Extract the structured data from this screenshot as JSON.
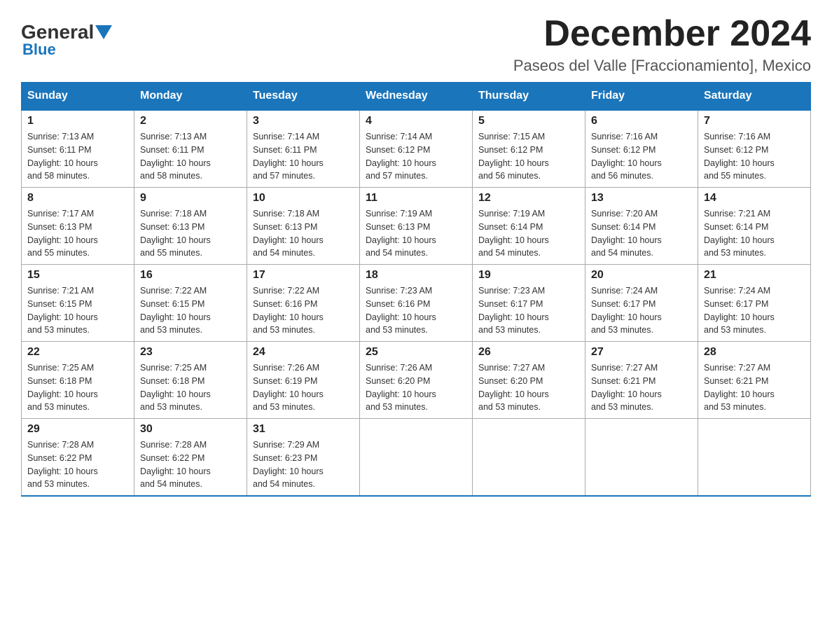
{
  "header": {
    "logo": {
      "general": "General",
      "blue": "Blue"
    },
    "title": "December 2024",
    "subtitle": "Paseos del Valle [Fraccionamiento], Mexico"
  },
  "calendar": {
    "days_of_week": [
      "Sunday",
      "Monday",
      "Tuesday",
      "Wednesday",
      "Thursday",
      "Friday",
      "Saturday"
    ],
    "weeks": [
      [
        {
          "day": "1",
          "sunrise": "7:13 AM",
          "sunset": "6:11 PM",
          "daylight": "10 hours and 58 minutes."
        },
        {
          "day": "2",
          "sunrise": "7:13 AM",
          "sunset": "6:11 PM",
          "daylight": "10 hours and 58 minutes."
        },
        {
          "day": "3",
          "sunrise": "7:14 AM",
          "sunset": "6:11 PM",
          "daylight": "10 hours and 57 minutes."
        },
        {
          "day": "4",
          "sunrise": "7:14 AM",
          "sunset": "6:12 PM",
          "daylight": "10 hours and 57 minutes."
        },
        {
          "day": "5",
          "sunrise": "7:15 AM",
          "sunset": "6:12 PM",
          "daylight": "10 hours and 56 minutes."
        },
        {
          "day": "6",
          "sunrise": "7:16 AM",
          "sunset": "6:12 PM",
          "daylight": "10 hours and 56 minutes."
        },
        {
          "day": "7",
          "sunrise": "7:16 AM",
          "sunset": "6:12 PM",
          "daylight": "10 hours and 55 minutes."
        }
      ],
      [
        {
          "day": "8",
          "sunrise": "7:17 AM",
          "sunset": "6:13 PM",
          "daylight": "10 hours and 55 minutes."
        },
        {
          "day": "9",
          "sunrise": "7:18 AM",
          "sunset": "6:13 PM",
          "daylight": "10 hours and 55 minutes."
        },
        {
          "day": "10",
          "sunrise": "7:18 AM",
          "sunset": "6:13 PM",
          "daylight": "10 hours and 54 minutes."
        },
        {
          "day": "11",
          "sunrise": "7:19 AM",
          "sunset": "6:13 PM",
          "daylight": "10 hours and 54 minutes."
        },
        {
          "day": "12",
          "sunrise": "7:19 AM",
          "sunset": "6:14 PM",
          "daylight": "10 hours and 54 minutes."
        },
        {
          "day": "13",
          "sunrise": "7:20 AM",
          "sunset": "6:14 PM",
          "daylight": "10 hours and 54 minutes."
        },
        {
          "day": "14",
          "sunrise": "7:21 AM",
          "sunset": "6:14 PM",
          "daylight": "10 hours and 53 minutes."
        }
      ],
      [
        {
          "day": "15",
          "sunrise": "7:21 AM",
          "sunset": "6:15 PM",
          "daylight": "10 hours and 53 minutes."
        },
        {
          "day": "16",
          "sunrise": "7:22 AM",
          "sunset": "6:15 PM",
          "daylight": "10 hours and 53 minutes."
        },
        {
          "day": "17",
          "sunrise": "7:22 AM",
          "sunset": "6:16 PM",
          "daylight": "10 hours and 53 minutes."
        },
        {
          "day": "18",
          "sunrise": "7:23 AM",
          "sunset": "6:16 PM",
          "daylight": "10 hours and 53 minutes."
        },
        {
          "day": "19",
          "sunrise": "7:23 AM",
          "sunset": "6:17 PM",
          "daylight": "10 hours and 53 minutes."
        },
        {
          "day": "20",
          "sunrise": "7:24 AM",
          "sunset": "6:17 PM",
          "daylight": "10 hours and 53 minutes."
        },
        {
          "day": "21",
          "sunrise": "7:24 AM",
          "sunset": "6:17 PM",
          "daylight": "10 hours and 53 minutes."
        }
      ],
      [
        {
          "day": "22",
          "sunrise": "7:25 AM",
          "sunset": "6:18 PM",
          "daylight": "10 hours and 53 minutes."
        },
        {
          "day": "23",
          "sunrise": "7:25 AM",
          "sunset": "6:18 PM",
          "daylight": "10 hours and 53 minutes."
        },
        {
          "day": "24",
          "sunrise": "7:26 AM",
          "sunset": "6:19 PM",
          "daylight": "10 hours and 53 minutes."
        },
        {
          "day": "25",
          "sunrise": "7:26 AM",
          "sunset": "6:20 PM",
          "daylight": "10 hours and 53 minutes."
        },
        {
          "day": "26",
          "sunrise": "7:27 AM",
          "sunset": "6:20 PM",
          "daylight": "10 hours and 53 minutes."
        },
        {
          "day": "27",
          "sunrise": "7:27 AM",
          "sunset": "6:21 PM",
          "daylight": "10 hours and 53 minutes."
        },
        {
          "day": "28",
          "sunrise": "7:27 AM",
          "sunset": "6:21 PM",
          "daylight": "10 hours and 53 minutes."
        }
      ],
      [
        {
          "day": "29",
          "sunrise": "7:28 AM",
          "sunset": "6:22 PM",
          "daylight": "10 hours and 53 minutes."
        },
        {
          "day": "30",
          "sunrise": "7:28 AM",
          "sunset": "6:22 PM",
          "daylight": "10 hours and 54 minutes."
        },
        {
          "day": "31",
          "sunrise": "7:29 AM",
          "sunset": "6:23 PM",
          "daylight": "10 hours and 54 minutes."
        },
        null,
        null,
        null,
        null
      ]
    ],
    "labels": {
      "sunrise": "Sunrise: ",
      "sunset": "Sunset: ",
      "daylight": "Daylight: "
    }
  }
}
